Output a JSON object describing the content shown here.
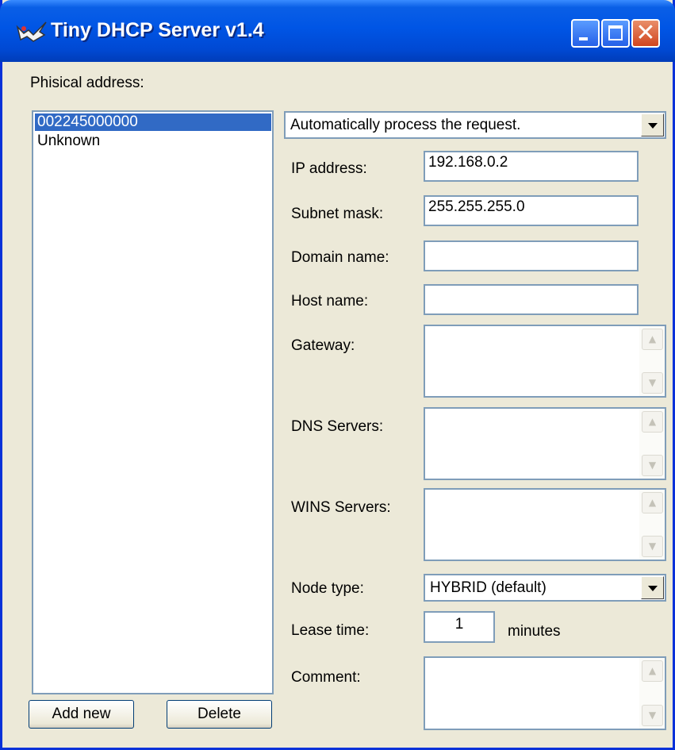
{
  "window": {
    "title": "Tiny DHCP Server v1.4"
  },
  "list": {
    "label": "Phisical address:",
    "items": [
      {
        "text": "002245000000",
        "selected": true
      },
      {
        "text": "Unknown",
        "selected": false
      }
    ],
    "add_label": "Add new",
    "delete_label": "Delete"
  },
  "action_select": {
    "value": "Automatically process the request."
  },
  "form": {
    "ip_label": "IP address:",
    "ip_value": "192.168.0.2",
    "subnet_label": "Subnet mask:",
    "subnet_value": "255.255.255.0",
    "domain_label": "Domain name:",
    "domain_value": "",
    "host_label": "Host name:",
    "host_value": "",
    "gateway_label": "Gateway:",
    "dns_label": "DNS Servers:",
    "wins_label": "WINS Servers:",
    "node_label": "Node type:",
    "node_value": "HYBRID (default)",
    "lease_label": "Lease time:",
    "lease_value": "1",
    "lease_unit": "minutes",
    "comment_label": "Comment:"
  },
  "colors": {
    "title_bar": "#0055e5",
    "selection": "#316ac5",
    "face": "#ece9d8",
    "border": "#7f9db9"
  },
  "icons": [
    "app-icon",
    "minimize-icon",
    "maximize-icon",
    "close-icon",
    "dropdown-arrow-icon",
    "scroll-up-icon",
    "scroll-down-icon"
  ]
}
